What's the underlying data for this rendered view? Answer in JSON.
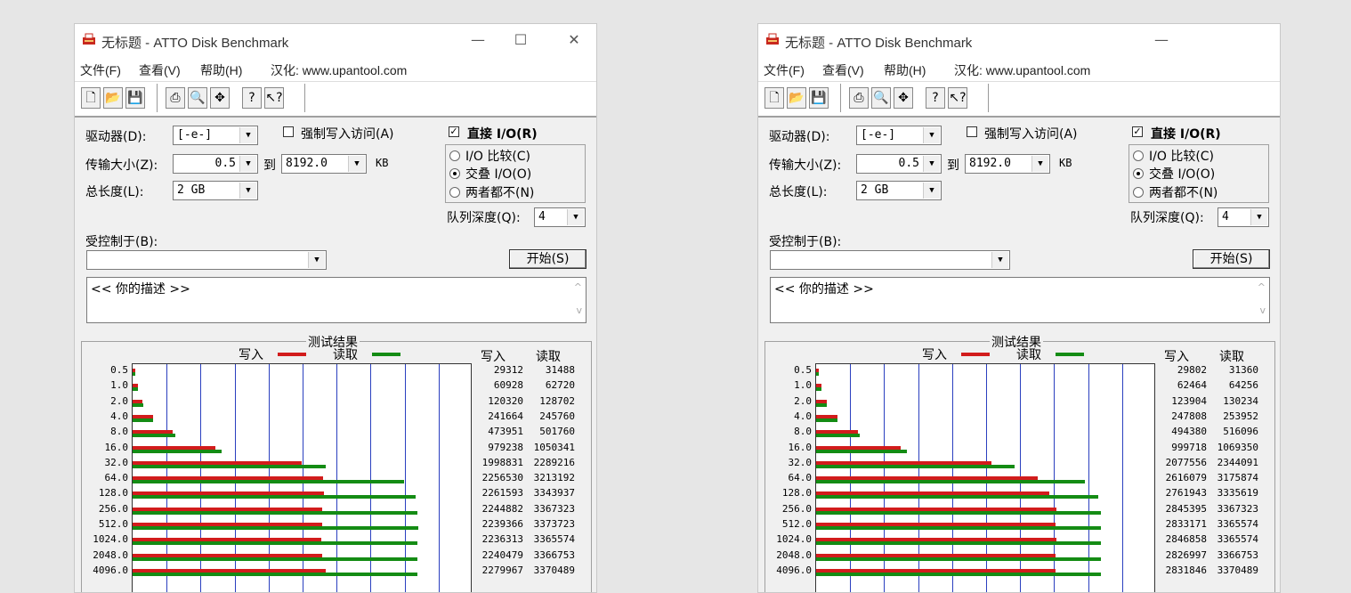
{
  "windows": [
    {
      "title": "无标题 - ATTO Disk Benchmark",
      "controls": [
        "—",
        "☐",
        "✕"
      ],
      "menu": [
        "文件(F)",
        "查看(V)",
        "帮助(H)",
        "汉化: www.upantool.com"
      ],
      "drive_label": "驱动器(D):",
      "drive_value": "[-e-]",
      "force_write_label": "强制写入访问(A)",
      "force_write_checked": false,
      "direct_io_label": "直接 I/O(R)",
      "direct_io_checked": true,
      "transfer_label": "传输大小(Z):",
      "transfer_from": "0.5",
      "to_label": "到",
      "transfer_to": "8192.0",
      "unit": "KB",
      "length_label": "总长度(L):",
      "length_value": "2 GB",
      "io_options": [
        "I/O 比较(C)",
        "交叠 I/O(O)",
        "两者都不(N)"
      ],
      "io_selected": 1,
      "queue_label": "队列深度(Q):",
      "queue_value": "4",
      "controlled_label": "受控制于(B):",
      "controlled_value": "",
      "start_label": "开始(S)",
      "description": "<<  你的描述   >>",
      "results_title": "测试结果",
      "legend_write": "写入",
      "legend_read": "读取",
      "col_write": "写入",
      "col_read": "读取",
      "sizes": [
        "0.5",
        "1.0",
        "2.0",
        "4.0",
        "8.0",
        "16.0",
        "32.0",
        "64.0",
        "128.0",
        "256.0",
        "512.0",
        "1024.0",
        "2048.0",
        "4096.0"
      ],
      "write": [
        29312,
        60928,
        120320,
        241664,
        473951,
        979238,
        1998831,
        2256530,
        2261593,
        2244882,
        2239366,
        2236313,
        2240479,
        2279967
      ],
      "read": [
        31488,
        62720,
        128702,
        245760,
        501760,
        1050341,
        2289216,
        3213192,
        3343937,
        3367323,
        3373723,
        3365574,
        3366753,
        3370489
      ],
      "show_restore": true
    },
    {
      "title": "无标题 - ATTO Disk Benchmark",
      "controls": [
        "—"
      ],
      "menu": [
        "文件(F)",
        "查看(V)",
        "帮助(H)",
        "汉化: www.upantool.com"
      ],
      "drive_label": "驱动器(D):",
      "drive_value": "[-e-]",
      "force_write_label": "强制写入访问(A)",
      "force_write_checked": false,
      "direct_io_label": "直接 I/O(R)",
      "direct_io_checked": true,
      "transfer_label": "传输大小(Z):",
      "transfer_from": "0.5",
      "to_label": "到",
      "transfer_to": "8192.0",
      "unit": "KB",
      "length_label": "总长度(L):",
      "length_value": "2 GB",
      "io_options": [
        "I/O 比较(C)",
        "交叠 I/O(O)",
        "两者都不(N)"
      ],
      "io_selected": 1,
      "queue_label": "队列深度(Q):",
      "queue_value": "4",
      "controlled_label": "受控制于(B):",
      "controlled_value": "",
      "start_label": "开始(S)",
      "description": "<<  你的描述   >>",
      "results_title": "测试结果",
      "legend_write": "写入",
      "legend_read": "读取",
      "col_write": "写入",
      "col_read": "读取",
      "sizes": [
        "0.5",
        "1.0",
        "2.0",
        "4.0",
        "8.0",
        "16.0",
        "32.0",
        "64.0",
        "128.0",
        "256.0",
        "512.0",
        "1024.0",
        "2048.0",
        "4096.0"
      ],
      "write": [
        29802,
        62464,
        123904,
        247808,
        494380,
        999718,
        2077556,
        2616079,
        2761943,
        2845395,
        2833171,
        2846858,
        2826997,
        2831846
      ],
      "read": [
        31360,
        64256,
        130234,
        253952,
        516096,
        1069350,
        2344091,
        3175874,
        3335619,
        3367323,
        3365574,
        3365574,
        3366753,
        3370489
      ],
      "show_restore": false
    }
  ],
  "chart_data": [
    {
      "type": "bar",
      "orientation": "horizontal",
      "title": "测试结果",
      "categories": [
        "0.5",
        "1.0",
        "2.0",
        "4.0",
        "8.0",
        "16.0",
        "32.0",
        "64.0",
        "128.0",
        "256.0",
        "512.0",
        "1024.0",
        "2048.0",
        "4096.0"
      ],
      "series": [
        {
          "name": "写入",
          "color": "#d21c1c",
          "values": [
            29312,
            60928,
            120320,
            241664,
            473951,
            979238,
            1998831,
            2256530,
            2261593,
            2244882,
            2239366,
            2236313,
            2240479,
            2279967
          ]
        },
        {
          "name": "读取",
          "color": "#148c14",
          "values": [
            31488,
            62720,
            128702,
            245760,
            501760,
            1050341,
            2289216,
            3213192,
            3343937,
            3367323,
            3373723,
            3365574,
            3366753,
            3370489
          ]
        }
      ],
      "xlim": [
        0,
        4000000
      ],
      "grid": true
    },
    {
      "type": "bar",
      "orientation": "horizontal",
      "title": "测试结果",
      "categories": [
        "0.5",
        "1.0",
        "2.0",
        "4.0",
        "8.0",
        "16.0",
        "32.0",
        "64.0",
        "128.0",
        "256.0",
        "512.0",
        "1024.0",
        "2048.0",
        "4096.0"
      ],
      "series": [
        {
          "name": "写入",
          "color": "#d21c1c",
          "values": [
            29802,
            62464,
            123904,
            247808,
            494380,
            999718,
            2077556,
            2616079,
            2761943,
            2845395,
            2833171,
            2846858,
            2826997,
            2831846
          ]
        },
        {
          "name": "读取",
          "color": "#148c14",
          "values": [
            31360,
            64256,
            130234,
            253952,
            516096,
            1069350,
            2344091,
            3175874,
            3335619,
            3367323,
            3365574,
            3365574,
            3366753,
            3370489
          ]
        }
      ],
      "xlim": [
        0,
        4000000
      ],
      "grid": true
    }
  ]
}
